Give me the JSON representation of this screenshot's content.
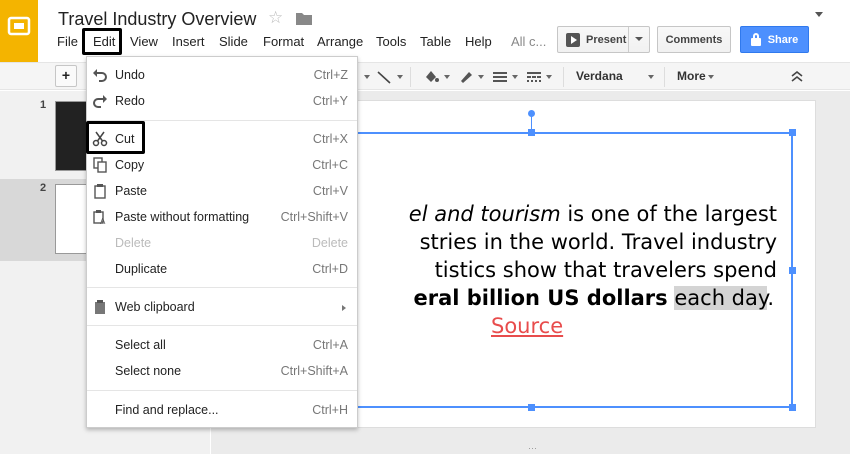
{
  "app": {
    "doc_title": "Travel Industry Overview",
    "logo_icon": "slides-logo-icon",
    "brand_color": "#f4b400"
  },
  "menubar": {
    "file": "File",
    "edit": "Edit",
    "view": "View",
    "insert": "Insert",
    "slide": "Slide",
    "format": "Format",
    "arrange": "Arrange",
    "tools": "Tools",
    "table": "Table",
    "help": "Help",
    "all_changes": "All c..."
  },
  "header_buttons": {
    "present": "Present",
    "comments": "Comments",
    "share": "Share",
    "share_color": "#4d90fe"
  },
  "toolbar": {
    "plus": "+",
    "font": "Verdana",
    "more": "More"
  },
  "filmstrip": {
    "slide1_num": "1",
    "slide2_num": "2"
  },
  "edit_menu": {
    "undo": {
      "label": "Undo",
      "shortcut": "Ctrl+Z"
    },
    "redo": {
      "label": "Redo",
      "shortcut": "Ctrl+Y"
    },
    "cut": {
      "label": "Cut",
      "shortcut": "Ctrl+X"
    },
    "copy": {
      "label": "Copy",
      "shortcut": "Ctrl+C"
    },
    "paste": {
      "label": "Paste",
      "shortcut": "Ctrl+V"
    },
    "paste_plain": {
      "label": "Paste without formatting",
      "shortcut": "Ctrl+Shift+V"
    },
    "delete": {
      "label": "Delete",
      "shortcut": "Delete"
    },
    "duplicate": {
      "label": "Duplicate",
      "shortcut": "Ctrl+D"
    },
    "web_clipboard": {
      "label": "Web clipboard"
    },
    "select_all": {
      "label": "Select all",
      "shortcut": "Ctrl+A"
    },
    "select_none": {
      "label": "Select none",
      "shortcut": "Ctrl+Shift+A"
    },
    "find_replace": {
      "label": "Find and replace...",
      "shortcut": "Ctrl+H"
    }
  },
  "slide_text": {
    "line1_italic": "el and tourism",
    "line1_rest": " is one of the largest",
    "line2": "stries in the world. Travel industry",
    "line3": "tistics show that travelers spend",
    "line4_bold": "eral billion US dollars",
    "line4_space": " ",
    "line4_highlight": "each day",
    "line4_end": ".",
    "source_link": "Source",
    "link_color": "#e84c4c"
  }
}
